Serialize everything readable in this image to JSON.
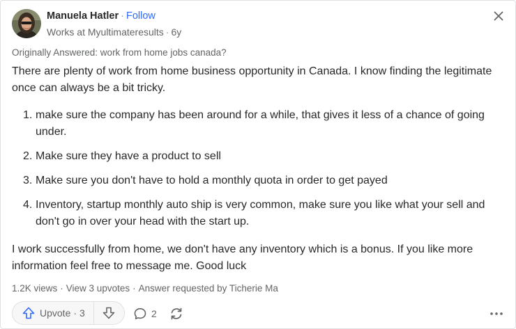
{
  "author": {
    "name": "Manuela Hatler",
    "follow_label": "Follow",
    "credential": "Works at Myultimateresults",
    "time_ago": "6y"
  },
  "originally_answered": "Originally Answered: work from home jobs canada?",
  "answer": {
    "intro": "There are plenty of work from home business opportunity in Canada. I know finding the legitimate once can always be a bit tricky.",
    "list": [
      {
        "num": "1.",
        "text": "make sure the company has been around for a while, that gives it less of a chance of going under."
      },
      {
        "num": "2.",
        "text": "Make sure they have a product to sell"
      },
      {
        "num": "3.",
        "text": "Make sure you don't have to hold a monthly quota in order to get payed"
      },
      {
        "num": "4.",
        "text": "Inventory, startup monthly auto ship is very common, make sure you like what your sell and don't go in over your head with the start up."
      }
    ],
    "closing": "I work successfully from home, we don't have any inventory which is a bonus. If you like more information feel free to message me. Good luck"
  },
  "stats": {
    "views": "1.2K views",
    "upvotes_link": "View 3 upvotes",
    "requested": "Answer requested by Ticherie Ma"
  },
  "actions": {
    "upvote_label": "Upvote",
    "upvote_count": "3",
    "comment_count": "2"
  },
  "icons": {
    "close": "close-icon",
    "upvote": "upvote-arrow-icon",
    "downvote": "downvote-arrow-icon",
    "comment": "comment-bubble-icon",
    "share": "share-cycle-icon",
    "more": "more-dots-icon"
  },
  "colors": {
    "link_blue": "#2e69ff",
    "text": "#282829",
    "muted": "#636466"
  }
}
